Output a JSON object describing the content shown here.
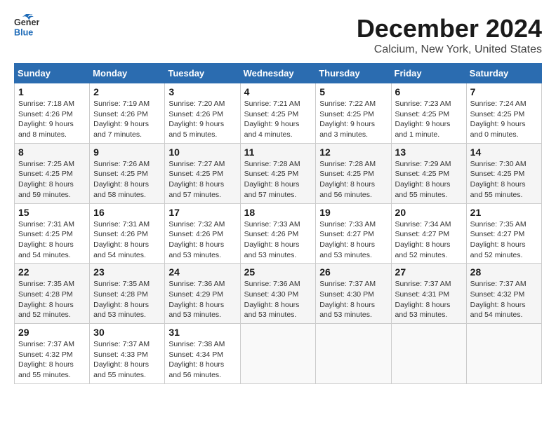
{
  "header": {
    "logo_general": "General",
    "logo_blue": "Blue",
    "month_title": "December 2024",
    "location": "Calcium, New York, United States"
  },
  "calendar": {
    "days_of_week": [
      "Sunday",
      "Monday",
      "Tuesday",
      "Wednesday",
      "Thursday",
      "Friday",
      "Saturday"
    ],
    "weeks": [
      [
        {
          "day": "1",
          "sunrise": "7:18 AM",
          "sunset": "4:26 PM",
          "daylight": "9 hours and 8 minutes."
        },
        {
          "day": "2",
          "sunrise": "7:19 AM",
          "sunset": "4:26 PM",
          "daylight": "9 hours and 7 minutes."
        },
        {
          "day": "3",
          "sunrise": "7:20 AM",
          "sunset": "4:26 PM",
          "daylight": "9 hours and 5 minutes."
        },
        {
          "day": "4",
          "sunrise": "7:21 AM",
          "sunset": "4:25 PM",
          "daylight": "9 hours and 4 minutes."
        },
        {
          "day": "5",
          "sunrise": "7:22 AM",
          "sunset": "4:25 PM",
          "daylight": "9 hours and 3 minutes."
        },
        {
          "day": "6",
          "sunrise": "7:23 AM",
          "sunset": "4:25 PM",
          "daylight": "9 hours and 1 minute."
        },
        {
          "day": "7",
          "sunrise": "7:24 AM",
          "sunset": "4:25 PM",
          "daylight": "9 hours and 0 minutes."
        }
      ],
      [
        {
          "day": "8",
          "sunrise": "7:25 AM",
          "sunset": "4:25 PM",
          "daylight": "8 hours and 59 minutes."
        },
        {
          "day": "9",
          "sunrise": "7:26 AM",
          "sunset": "4:25 PM",
          "daylight": "8 hours and 58 minutes."
        },
        {
          "day": "10",
          "sunrise": "7:27 AM",
          "sunset": "4:25 PM",
          "daylight": "8 hours and 57 minutes."
        },
        {
          "day": "11",
          "sunrise": "7:28 AM",
          "sunset": "4:25 PM",
          "daylight": "8 hours and 57 minutes."
        },
        {
          "day": "12",
          "sunrise": "7:28 AM",
          "sunset": "4:25 PM",
          "daylight": "8 hours and 56 minutes."
        },
        {
          "day": "13",
          "sunrise": "7:29 AM",
          "sunset": "4:25 PM",
          "daylight": "8 hours and 55 minutes."
        },
        {
          "day": "14",
          "sunrise": "7:30 AM",
          "sunset": "4:25 PM",
          "daylight": "8 hours and 55 minutes."
        }
      ],
      [
        {
          "day": "15",
          "sunrise": "7:31 AM",
          "sunset": "4:25 PM",
          "daylight": "8 hours and 54 minutes."
        },
        {
          "day": "16",
          "sunrise": "7:31 AM",
          "sunset": "4:26 PM",
          "daylight": "8 hours and 54 minutes."
        },
        {
          "day": "17",
          "sunrise": "7:32 AM",
          "sunset": "4:26 PM",
          "daylight": "8 hours and 53 minutes."
        },
        {
          "day": "18",
          "sunrise": "7:33 AM",
          "sunset": "4:26 PM",
          "daylight": "8 hours and 53 minutes."
        },
        {
          "day": "19",
          "sunrise": "7:33 AM",
          "sunset": "4:27 PM",
          "daylight": "8 hours and 53 minutes."
        },
        {
          "day": "20",
          "sunrise": "7:34 AM",
          "sunset": "4:27 PM",
          "daylight": "8 hours and 52 minutes."
        },
        {
          "day": "21",
          "sunrise": "7:35 AM",
          "sunset": "4:27 PM",
          "daylight": "8 hours and 52 minutes."
        }
      ],
      [
        {
          "day": "22",
          "sunrise": "7:35 AM",
          "sunset": "4:28 PM",
          "daylight": "8 hours and 52 minutes."
        },
        {
          "day": "23",
          "sunrise": "7:35 AM",
          "sunset": "4:28 PM",
          "daylight": "8 hours and 53 minutes."
        },
        {
          "day": "24",
          "sunrise": "7:36 AM",
          "sunset": "4:29 PM",
          "daylight": "8 hours and 53 minutes."
        },
        {
          "day": "25",
          "sunrise": "7:36 AM",
          "sunset": "4:30 PM",
          "daylight": "8 hours and 53 minutes."
        },
        {
          "day": "26",
          "sunrise": "7:37 AM",
          "sunset": "4:30 PM",
          "daylight": "8 hours and 53 minutes."
        },
        {
          "day": "27",
          "sunrise": "7:37 AM",
          "sunset": "4:31 PM",
          "daylight": "8 hours and 53 minutes."
        },
        {
          "day": "28",
          "sunrise": "7:37 AM",
          "sunset": "4:32 PM",
          "daylight": "8 hours and 54 minutes."
        }
      ],
      [
        {
          "day": "29",
          "sunrise": "7:37 AM",
          "sunset": "4:32 PM",
          "daylight": "8 hours and 55 minutes."
        },
        {
          "day": "30",
          "sunrise": "7:37 AM",
          "sunset": "4:33 PM",
          "daylight": "8 hours and 55 minutes."
        },
        {
          "day": "31",
          "sunrise": "7:38 AM",
          "sunset": "4:34 PM",
          "daylight": "8 hours and 56 minutes."
        },
        null,
        null,
        null,
        null
      ]
    ]
  }
}
